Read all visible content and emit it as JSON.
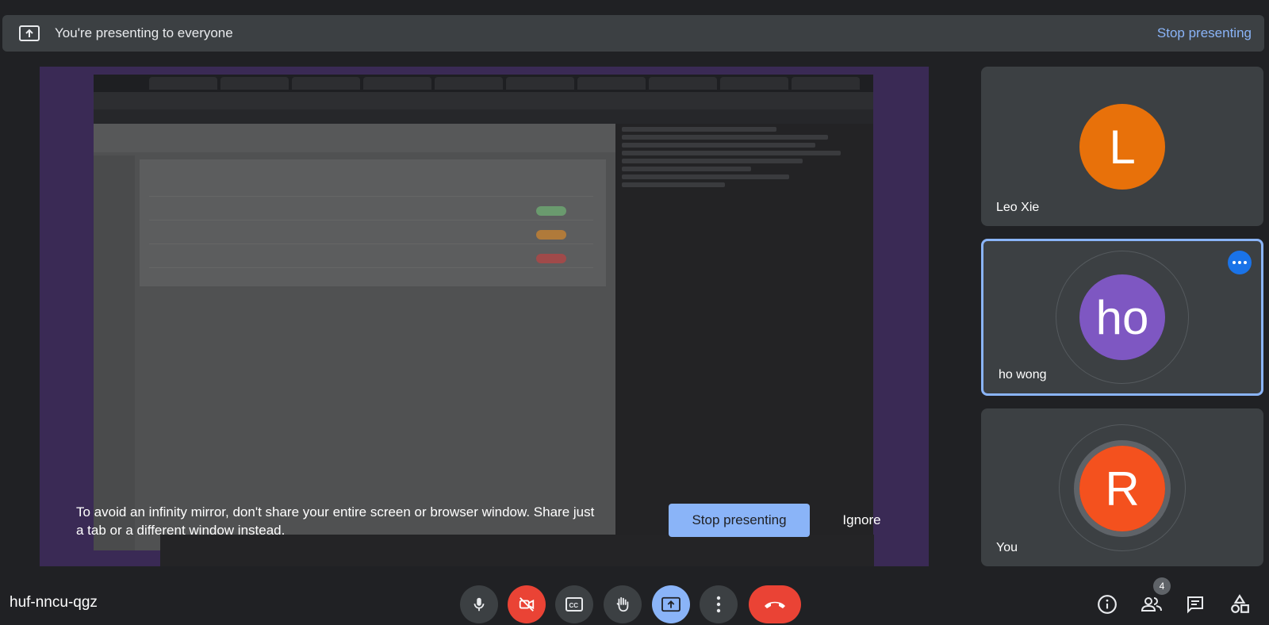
{
  "banner": {
    "text": "You're presenting to everyone",
    "stop_label": "Stop presenting",
    "icon": "present-to-all-icon"
  },
  "warning": {
    "text": "To avoid an infinity mirror, don't share your entire screen or browser window. Share just a tab or a different window instead.",
    "stop_label": "Stop presenting",
    "ignore_label": "Ignore"
  },
  "participants": [
    {
      "name": "Leo Xie",
      "initial": "L",
      "color": "#e8710a"
    },
    {
      "name": "ho wong",
      "initial": "ho",
      "color": "#7e57c2"
    },
    {
      "name": "You",
      "initial": "R",
      "color": "#f4511e"
    }
  ],
  "meeting": {
    "code": "huf-nncu-qgz"
  },
  "controls": {
    "mic": "mic-icon",
    "camera": "camera-off-icon",
    "captions": "captions-icon",
    "raise_hand": "raise-hand-icon",
    "present": "present-icon",
    "more": "more-options-icon",
    "hangup": "hang-up-icon"
  },
  "people_count": "4",
  "colors": {
    "accent": "#8ab4f8",
    "danger": "#ea4335",
    "tile": "#3c4043",
    "background": "#202124"
  }
}
